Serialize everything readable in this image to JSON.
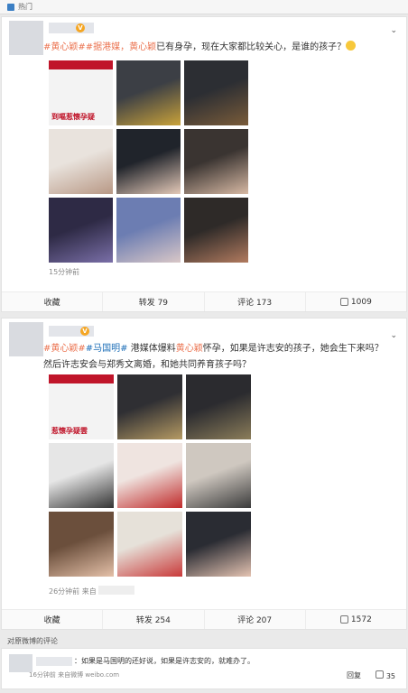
{
  "section": {
    "label": "热门"
  },
  "posts": [
    {
      "text_parts": [
        {
          "t": "#黄心颖#",
          "c": "tag"
        },
        {
          "t": "#据港媒，",
          "c": "tag"
        },
        {
          "t": "黄心颖",
          "c": "link"
        },
        {
          "t": "已有身孕，现在大家都比较关心，是谁的孩子？",
          "c": ""
        }
      ],
      "image_captions": [
        "到嘔惹懷孕疑",
        "",
        "",
        "",
        "",
        "",
        "",
        "",
        ""
      ],
      "time": "15分钟前",
      "actions": {
        "collect": "收藏",
        "repost": "转发 79",
        "comment": "评论 173",
        "like": "1009"
      }
    },
    {
      "text_parts": [
        {
          "t": "#黄心颖#",
          "c": "tag"
        },
        {
          "t": "#马国明#",
          "c": "blue"
        },
        {
          "t": " 港媒体爆料",
          "c": ""
        },
        {
          "t": "黄心颖",
          "c": "link"
        },
        {
          "t": "怀孕，如果是许志安的孩子，她会生下来吗？然后许志安会与郑秀文离婚，和她共同养育孩子吗？",
          "c": ""
        }
      ],
      "image_captions": [
        "惹懷孕疑雲",
        "",
        "",
        "",
        "",
        "",
        "",
        "",
        ""
      ],
      "time": "26分钟前 来自",
      "actions": {
        "collect": "收藏",
        "repost": "转发 254",
        "comment": "评论 207",
        "like": "1572"
      }
    }
  ],
  "comments_section": {
    "label": "对原微博的评论",
    "text": "：如果是马国明的还好说，如果是许志安的，就难办了。",
    "meta": "16分钟前 来自微博 weibo.com",
    "reply": "回复",
    "likes": "35"
  }
}
